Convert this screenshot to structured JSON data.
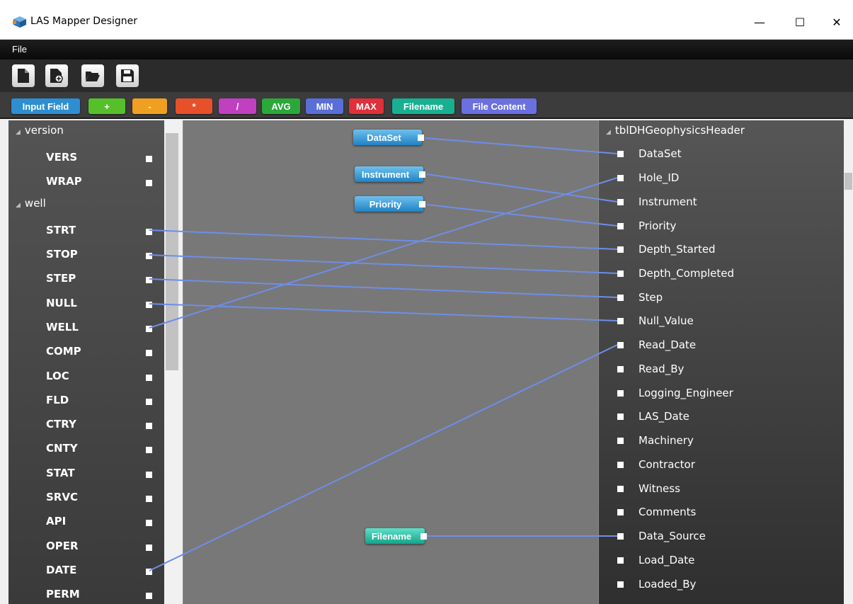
{
  "window": {
    "title": "LAS Mapper Designer",
    "minimize": "—",
    "maximize": "☐",
    "close": "✕"
  },
  "menu": {
    "file": "File"
  },
  "toolbar": {
    "icons": [
      "new-file-icon",
      "add-file-icon",
      "open-folder-icon",
      "save-icon"
    ]
  },
  "operators": [
    {
      "label": "Input Field",
      "color": "#2d8fd0"
    },
    {
      "label": "+",
      "color": "#56c02a"
    },
    {
      "label": "-",
      "color": "#f0a020"
    },
    {
      "label": "*",
      "color": "#e8502a"
    },
    {
      "label": "/",
      "color": "#c040c0"
    },
    {
      "label": "AVG",
      "color": "#2aa83a"
    },
    {
      "label": "MIN",
      "color": "#5a6ed8"
    },
    {
      "label": "MAX",
      "color": "#e0303a"
    },
    {
      "label": "Filename",
      "color": "#18b090"
    },
    {
      "label": "File Content",
      "color": "#6a70e0"
    }
  ],
  "source": {
    "groups": [
      {
        "name": "version",
        "fields": [
          "VERS",
          "WRAP"
        ]
      },
      {
        "name": "well",
        "fields": [
          "STRT",
          "STOP",
          "STEP",
          "NULL",
          "WELL",
          "COMP",
          "LOC",
          "FLD",
          "CTRY",
          "CNTY",
          "STAT",
          "SRVC",
          "API",
          "OPER",
          "DATE",
          "PERM"
        ]
      }
    ]
  },
  "canvas_nodes": [
    {
      "label": "DataSet",
      "kind": "Input Field"
    },
    {
      "label": "Instrument",
      "kind": "Input Field"
    },
    {
      "label": "Priority",
      "kind": "Input Field"
    },
    {
      "label": "Filename",
      "kind": "Filename"
    }
  ],
  "target": {
    "table": "tblDHGeophysicsHeader",
    "fields": [
      "DataSet",
      "Hole_ID",
      "Instrument",
      "Priority",
      "Depth_Started",
      "Depth_Completed",
      "Step",
      "Null_Value",
      "Read_Date",
      "Read_By",
      "Logging_Engineer",
      "LAS_Date",
      "Machinery",
      "Contractor",
      "Witness",
      "Comments",
      "Data_Source",
      "Load_Date",
      "Loaded_By"
    ]
  },
  "mappings": [
    {
      "from": "DataSet",
      "to": "DataSet"
    },
    {
      "from": "Instrument",
      "to": "Instrument"
    },
    {
      "from": "Priority",
      "to": "Priority"
    },
    {
      "from": "STRT",
      "to": "Depth_Started"
    },
    {
      "from": "STOP",
      "to": "Depth_Completed"
    },
    {
      "from": "STEP",
      "to": "Step"
    },
    {
      "from": "NULL",
      "to": "Null_Value"
    },
    {
      "from": "WELL",
      "to": "Hole_ID"
    },
    {
      "from": "DATE",
      "to": "Read_Date"
    },
    {
      "from": "Filename",
      "to": "Data_Source"
    }
  ],
  "colors": {
    "wire": "#6e8ee8"
  }
}
